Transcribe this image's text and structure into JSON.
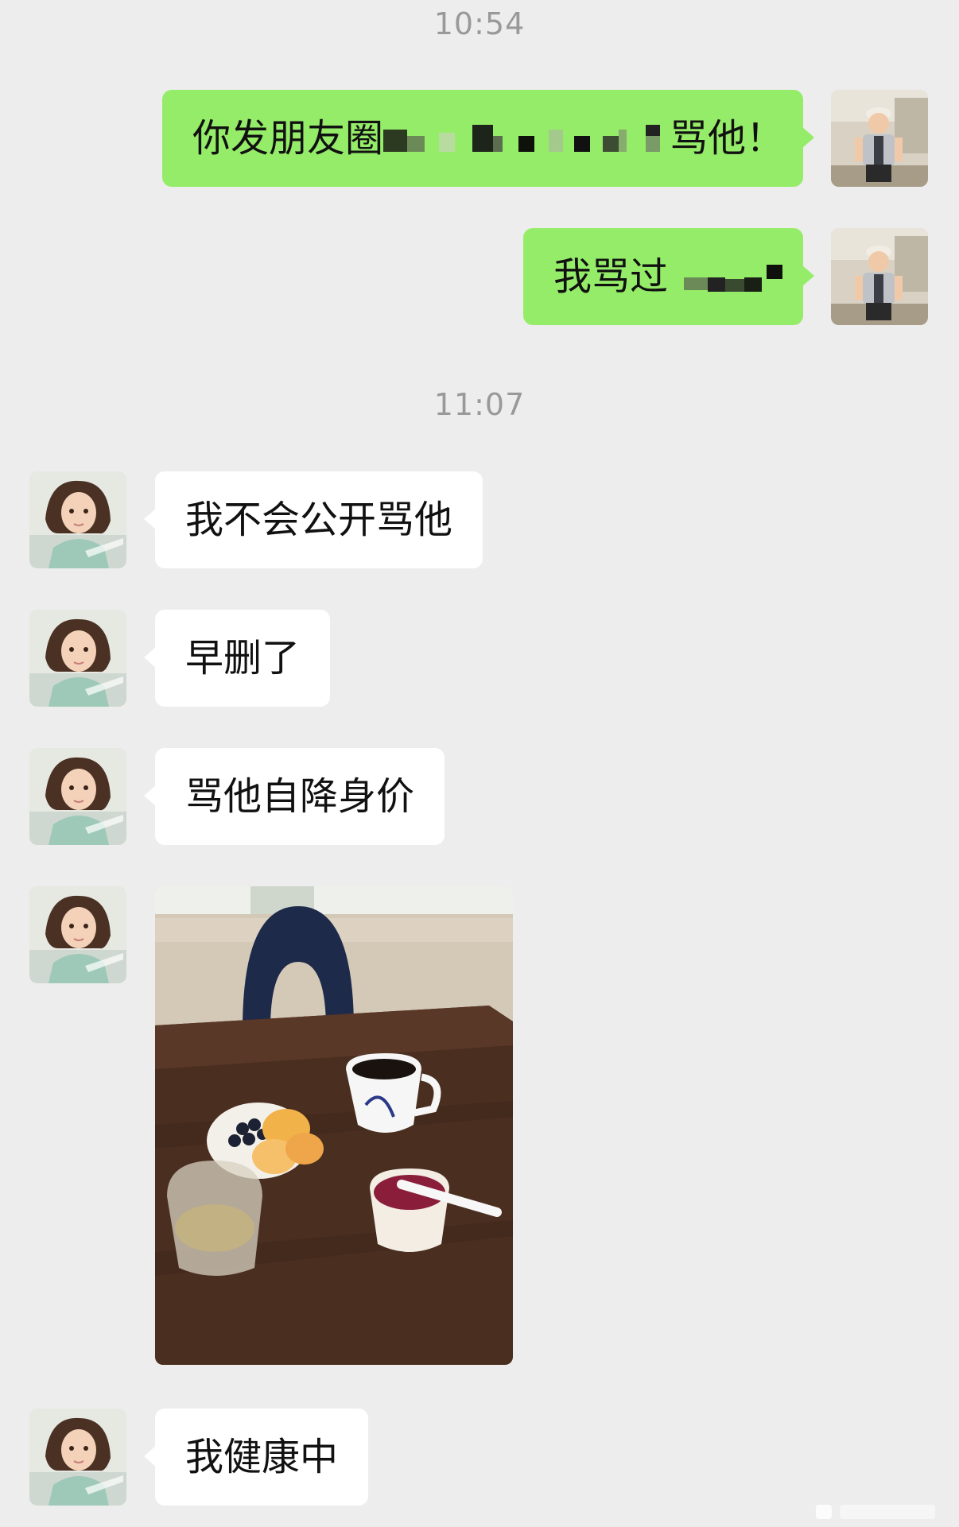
{
  "chat": {
    "timestamps": [
      "10:54",
      "11:07"
    ],
    "messages": [
      {
        "side": "sent",
        "type": "text",
        "text_before": "你发朋友圈",
        "text_after": "骂他！",
        "redacted": true
      },
      {
        "side": "sent",
        "type": "text",
        "text_before": "我骂过",
        "redacted": true
      },
      {
        "side": "received",
        "type": "text",
        "text": "我不会公开骂他"
      },
      {
        "side": "received",
        "type": "text",
        "text": "早删了"
      },
      {
        "side": "received",
        "type": "text",
        "text": "骂他自降身价"
      },
      {
        "side": "received",
        "type": "image",
        "icon": "breakfast-photo"
      },
      {
        "side": "received",
        "type": "text",
        "text": "我健康中"
      }
    ]
  },
  "colors": {
    "background": "#ededed",
    "sent_bubble": "#95ec69",
    "received_bubble": "#ffffff",
    "timestamp": "#999999"
  },
  "icons": {
    "sent_avatar": "boy-avatar",
    "received_avatar": "girl-avatar"
  }
}
